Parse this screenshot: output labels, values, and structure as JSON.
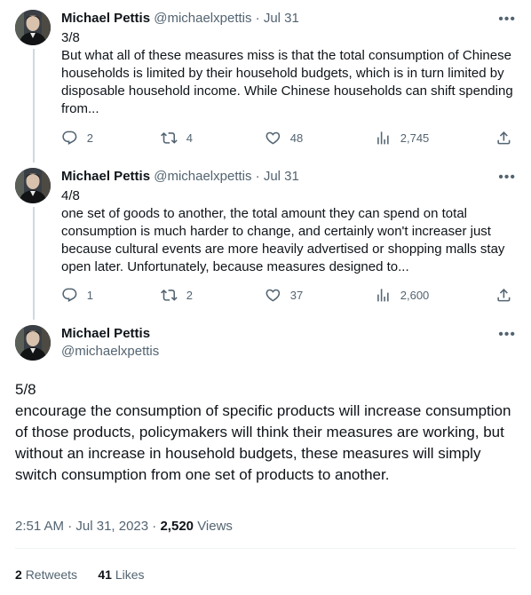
{
  "tweets": [
    {
      "author": "Michael Pettis",
      "handle": "@michaelxpettis",
      "separator": "·",
      "date": "Jul 31",
      "label": "3/8",
      "text": "But what all of these measures miss is that the total consumption of Chinese households is limited by their household budgets, which is in turn limited by disposable household income. While Chinese households can shift spending from...",
      "replies": "2",
      "retweets": "4",
      "likes": "48",
      "views": "2,745"
    },
    {
      "author": "Michael Pettis",
      "handle": "@michaelxpettis",
      "separator": "·",
      "date": "Jul 31",
      "label": "4/8",
      "text": "one set of goods to another, the total amount they can spend on total consumption is much harder to change, and certainly won't increaser just because cultural events are more heavily advertised or shopping malls stay open later. Unfortunately, because measures designed to...",
      "replies": "1",
      "retweets": "2",
      "likes": "37",
      "views": "2,600"
    }
  ],
  "main": {
    "author": "Michael Pettis",
    "handle": "@michaelxpettis",
    "label": "5/8",
    "text": "encourage the consumption of specific products will increase consumption of those products, policymakers will think their measures are working, but without an increase in household budgets, these measures will simply switch consumption from one set of products to another.",
    "time": "2:51 AM",
    "separator": "·",
    "date": "Jul 31, 2023",
    "views_count": "2,520",
    "views_label": "Views",
    "retweets_count": "2",
    "retweets_label": "Retweets",
    "likes_count": "41",
    "likes_label": "Likes"
  },
  "icons": {
    "more": "more-horizontal-icon",
    "reply": "reply-icon",
    "retweet": "retweet-icon",
    "like": "heart-icon",
    "views": "views-bar-chart-icon",
    "share": "share-icon"
  },
  "colors": {
    "text": "#0f1419",
    "secondary": "#536471",
    "thread_line": "#cfd9de",
    "divider": "#eff3f4"
  }
}
